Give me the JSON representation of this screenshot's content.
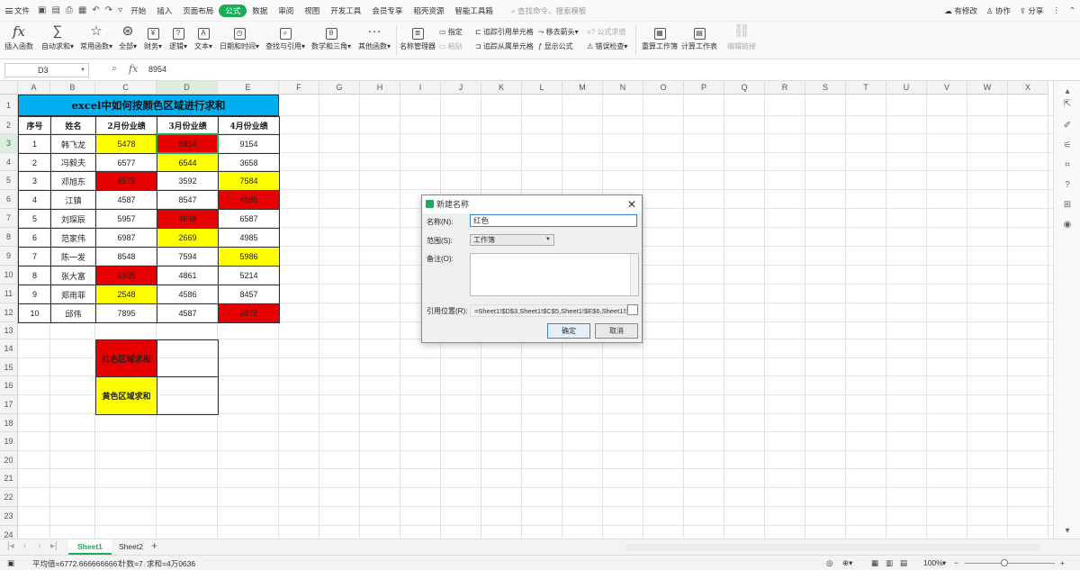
{
  "menubar": {
    "file": "文件",
    "tabs": [
      "开始",
      "插入",
      "页面布局",
      "公式",
      "数据",
      "审阅",
      "视图",
      "开发工具",
      "会员专享",
      "稻壳资源",
      "智能工具箱"
    ],
    "active_tab": "公式",
    "search": "查找命令、搜索模板",
    "right": [
      "有修改",
      "协作",
      "分享"
    ]
  },
  "ribbon": {
    "big_buttons": [
      {
        "label": "插入函数",
        "icon": "fx-icon"
      },
      {
        "label": "自动求和",
        "icon": "sigma-icon"
      },
      {
        "label": "常用函数",
        "icon": "star-icon"
      },
      {
        "label": "全部",
        "icon": "all-functions-icon"
      },
      {
        "label": "财务",
        "icon": "finance-icon"
      },
      {
        "label": "逻辑",
        "icon": "logic-icon"
      },
      {
        "label": "文本",
        "icon": "text-icon"
      },
      {
        "label": "日期和时间",
        "icon": "datetime-icon"
      },
      {
        "label": "查找与引用",
        "icon": "lookup-icon"
      },
      {
        "label": "数学和三角",
        "icon": "math-icon"
      },
      {
        "label": "其他函数",
        "icon": "more-icon"
      },
      {
        "label": "名称管理器",
        "icon": "name-manager-icon"
      }
    ],
    "small": {
      "define": "指定",
      "paste": "粘贴",
      "trace_precedents": "追踪引用单元格",
      "trace_dependents": "追踪从属单元格",
      "remove_arrows": "移去箭头",
      "show_formulas": "显示公式",
      "formula_eval": "公式求值",
      "error_check": "错误检查"
    },
    "right_buttons": [
      "重算工作簿",
      "计算工作表",
      "编辑链接"
    ]
  },
  "formula_bar": {
    "cell_ref": "D3",
    "fx": "fx",
    "content": "8954"
  },
  "columns": [
    "A",
    "B",
    "C",
    "D",
    "E",
    "F",
    "G",
    "H",
    "I",
    "J",
    "K",
    "L",
    "M",
    "N",
    "O",
    "P",
    "Q",
    "R",
    "S",
    "T",
    "U",
    "V",
    "W",
    "X"
  ],
  "rows": [
    "1",
    "2",
    "3",
    "4",
    "5",
    "6",
    "7",
    "8",
    "9",
    "10",
    "11",
    "12",
    "13",
    "14",
    "15",
    "16",
    "17",
    "18",
    "19",
    "20",
    "21",
    "22",
    "23",
    "24"
  ],
  "sheet": {
    "title": "excel中如何按颜色区域进行求和",
    "headers": [
      "序号",
      "姓名",
      "2月份业绩",
      "3月份业绩",
      "4月份业绩"
    ],
    "data": [
      {
        "n": "1",
        "name": "韩飞龙",
        "c": "5478",
        "d": "8954",
        "e": "9154"
      },
      {
        "n": "2",
        "name": "冯毅夫",
        "c": "6577",
        "d": "6544",
        "e": "3658"
      },
      {
        "n": "3",
        "name": "邓旭东",
        "c": "9575",
        "d": "3592",
        "e": "7584"
      },
      {
        "n": "4",
        "name": "江镇",
        "c": "4587",
        "d": "8547",
        "e": "4589"
      },
      {
        "n": "5",
        "name": "刘琛辰",
        "c": "5957",
        "d": "3658",
        "e": "6587"
      },
      {
        "n": "6",
        "name": "范家伟",
        "c": "6987",
        "d": "2669",
        "e": "4985"
      },
      {
        "n": "7",
        "name": "陈一发",
        "c": "8548",
        "d": "7594",
        "e": "5986"
      },
      {
        "n": "8",
        "name": "张大富",
        "c": "6985",
        "d": "4861",
        "e": "5214"
      },
      {
        "n": "9",
        "name": "郑雨菲",
        "c": "2548",
        "d": "4586",
        "e": "8457"
      },
      {
        "n": "10",
        "name": "邱伟",
        "c": "7895",
        "d": "4587",
        "e": "6875"
      }
    ],
    "fills": [
      {
        "c": "yellow",
        "d": "red",
        "e": ""
      },
      {
        "c": "",
        "d": "yellow",
        "e": ""
      },
      {
        "c": "red",
        "d": "",
        "e": "yellow"
      },
      {
        "c": "",
        "d": "",
        "e": "red"
      },
      {
        "c": "",
        "d": "red",
        "e": ""
      },
      {
        "c": "",
        "d": "yellow",
        "e": ""
      },
      {
        "c": "",
        "d": "",
        "e": "yellow"
      },
      {
        "c": "red",
        "d": "",
        "e": ""
      },
      {
        "c": "yellow",
        "d": "",
        "e": ""
      },
      {
        "c": "",
        "d": "",
        "e": "red"
      }
    ],
    "sum_red_label": "红色区域求和",
    "sum_yellow_label": "黄色区域求和"
  },
  "colors": {
    "red": "#e60000",
    "yellow": "#ffff00",
    "title_bg": "#00b0f0",
    "accent": "#1aad59"
  },
  "sheet_tabs": [
    "Sheet1",
    "Sheet2"
  ],
  "active_sheet": "Sheet1",
  "status": {
    "average": "平均值=6772.6666666667",
    "count": "计数=7",
    "sum": "求和=4万0636",
    "zoom": "100%"
  },
  "dialog": {
    "title": "新建名称",
    "name_label": "名称(N):",
    "name_value": "红色",
    "scope_label": "范围(S):",
    "scope_value": "工作簿",
    "note_label": "备注(O):",
    "ref_label": "引用位置(R):",
    "ref_value": "=Sheet1!$D$3,Sheet1!$C$5,Sheet1!$E$6,Sheet1!$D$7,Sheet1!$C$10,Sheet1!$E$12",
    "ok": "确定",
    "cancel": "取消"
  }
}
